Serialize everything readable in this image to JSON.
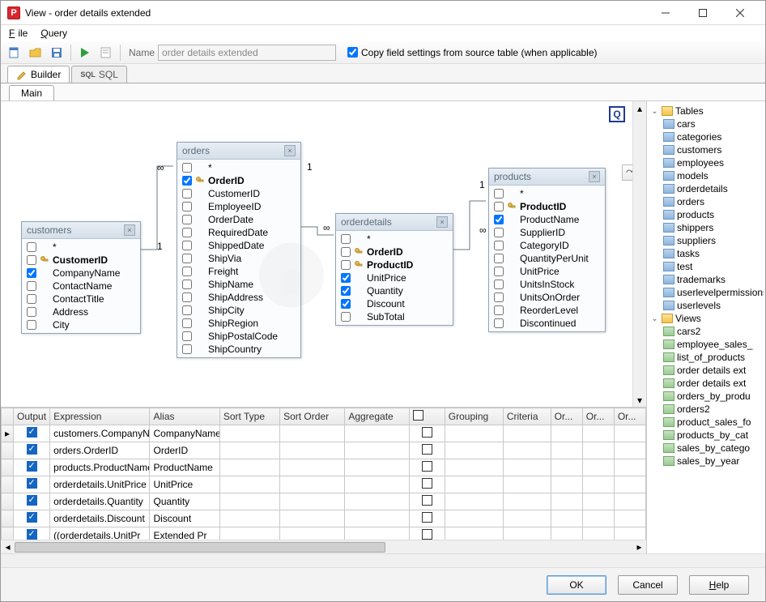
{
  "window": {
    "title": "View - order details extended"
  },
  "menu": {
    "file": "File",
    "query": "Query"
  },
  "toolbar": {
    "name_label": "Name",
    "name_value": "order details extended",
    "copy_fields_label": "Copy field settings from source table (when applicable)"
  },
  "tabs": {
    "builder": "Builder",
    "sql": "SQL",
    "main": "Main",
    "sql2": "SQL"
  },
  "diagram": {
    "customers": {
      "title": "customers",
      "fields": [
        "*",
        "CustomerID",
        "CompanyName",
        "ContactName",
        "ContactTitle",
        "Address",
        "City"
      ],
      "key": "CustomerID",
      "checked": [
        "CompanyName"
      ]
    },
    "orders": {
      "title": "orders",
      "fields": [
        "*",
        "OrderID",
        "CustomerID",
        "EmployeeID",
        "OrderDate",
        "RequiredDate",
        "ShippedDate",
        "ShipVia",
        "Freight",
        "ShipName",
        "ShipAddress",
        "ShipCity",
        "ShipRegion",
        "ShipPostalCode",
        "ShipCountry"
      ],
      "key": "OrderID",
      "checked": [
        "OrderID"
      ]
    },
    "orderdetails": {
      "title": "orderdetails",
      "fields": [
        "*",
        "OrderID",
        "ProductID",
        "UnitPrice",
        "Quantity",
        "Discount",
        "SubTotal"
      ],
      "keys": [
        "OrderID",
        "ProductID"
      ],
      "checked": [
        "UnitPrice",
        "Quantity",
        "Discount"
      ]
    },
    "products": {
      "title": "products",
      "fields": [
        "*",
        "ProductID",
        "ProductName",
        "SupplierID",
        "CategoryID",
        "QuantityPerUnit",
        "UnitPrice",
        "UnitsInStock",
        "UnitsOnOrder",
        "ReorderLevel",
        "Discontinued"
      ],
      "key": "ProductID",
      "checked": [
        "ProductName"
      ]
    }
  },
  "grid": {
    "headers": [
      "Output",
      "Expression",
      "Alias",
      "Sort Type",
      "Sort Order",
      "Aggregate",
      "",
      "Grouping",
      "Criteria",
      "Or...",
      "Or...",
      "Or..."
    ],
    "rows": [
      {
        "out": true,
        "expr": "customers.CompanyName",
        "alias": "CompanyName"
      },
      {
        "out": true,
        "expr": "orders.OrderID",
        "alias": "OrderID"
      },
      {
        "out": true,
        "expr": "products.ProductName",
        "alias": "ProductName"
      },
      {
        "out": true,
        "expr": "orderdetails.UnitPrice",
        "alias": "UnitPrice"
      },
      {
        "out": true,
        "expr": "orderdetails.Quantity",
        "alias": "Quantity"
      },
      {
        "out": true,
        "expr": "orderdetails.Discount",
        "alias": "Discount"
      },
      {
        "out": true,
        "expr": "((orderdetails.UnitPr",
        "alias": "Extended Pr"
      }
    ]
  },
  "tree": {
    "tables_label": "Tables",
    "tables": [
      "cars",
      "categories",
      "customers",
      "employees",
      "models",
      "orderdetails",
      "orders",
      "products",
      "shippers",
      "suppliers",
      "tasks",
      "test",
      "trademarks",
      "userlevelpermissions",
      "userlevels"
    ],
    "views_label": "Views",
    "views": [
      "cars2",
      "employee_sales_",
      "list_of_products",
      "order details ext",
      "order details ext",
      "orders_by_produ",
      "orders2",
      "product_sales_fo",
      "products_by_cat",
      "sales_by_catego",
      "sales_by_year"
    ]
  },
  "footer": {
    "ok": "OK",
    "cancel": "Cancel",
    "help": "Help"
  },
  "rel": {
    "one": "1",
    "many": "∞"
  }
}
